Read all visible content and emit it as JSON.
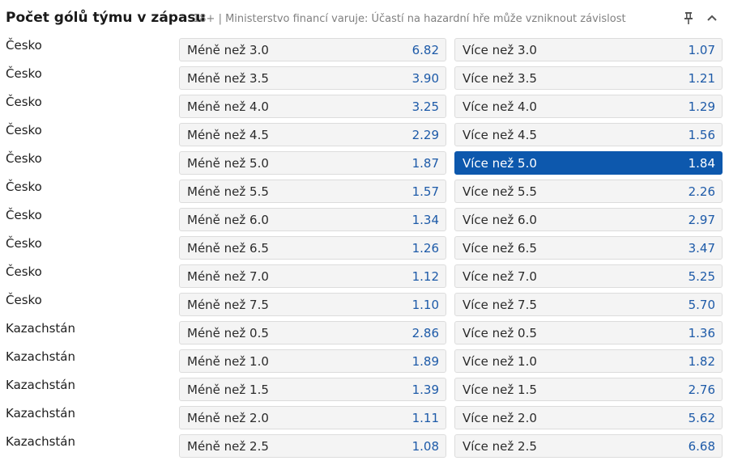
{
  "header": {
    "title": "Počet gólů týmu v zápasu",
    "disclaimer": "18+ | Ministerstvo financí varuje: Účastí na hazardní hře může vzniknout závislost",
    "pin_icon": "pin-icon",
    "collapse_icon": "chevron-up-icon"
  },
  "colors": {
    "accent": "#0d58ad",
    "odds_text": "#1d5aa8",
    "button_bg": "#f4f4f4"
  },
  "rows": [
    {
      "team": "Česko",
      "under": {
        "label": "Méně než 3.0",
        "odds": "6.82"
      },
      "over": {
        "label": "Více než 3.0",
        "odds": "1.07"
      }
    },
    {
      "team": "Česko",
      "under": {
        "label": "Méně než 3.5",
        "odds": "3.90"
      },
      "over": {
        "label": "Více než 3.5",
        "odds": "1.21"
      }
    },
    {
      "team": "Česko",
      "under": {
        "label": "Méně než 4.0",
        "odds": "3.25"
      },
      "over": {
        "label": "Více než 4.0",
        "odds": "1.29"
      }
    },
    {
      "team": "Česko",
      "under": {
        "label": "Méně než 4.5",
        "odds": "2.29"
      },
      "over": {
        "label": "Více než 4.5",
        "odds": "1.56"
      }
    },
    {
      "team": "Česko",
      "under": {
        "label": "Méně než 5.0",
        "odds": "1.87"
      },
      "over": {
        "label": "Více než 5.0",
        "odds": "1.84",
        "selected": true
      }
    },
    {
      "team": "Česko",
      "under": {
        "label": "Méně než 5.5",
        "odds": "1.57"
      },
      "over": {
        "label": "Více než 5.5",
        "odds": "2.26"
      }
    },
    {
      "team": "Česko",
      "under": {
        "label": "Méně než 6.0",
        "odds": "1.34"
      },
      "over": {
        "label": "Více než 6.0",
        "odds": "2.97"
      }
    },
    {
      "team": "Česko",
      "under": {
        "label": "Méně než 6.5",
        "odds": "1.26"
      },
      "over": {
        "label": "Více než 6.5",
        "odds": "3.47"
      }
    },
    {
      "team": "Česko",
      "under": {
        "label": "Méně než 7.0",
        "odds": "1.12"
      },
      "over": {
        "label": "Více než 7.0",
        "odds": "5.25"
      }
    },
    {
      "team": "Česko",
      "under": {
        "label": "Méně než 7.5",
        "odds": "1.10"
      },
      "over": {
        "label": "Více než 7.5",
        "odds": "5.70"
      }
    },
    {
      "team": "Kazachstán",
      "under": {
        "label": "Méně než 0.5",
        "odds": "2.86"
      },
      "over": {
        "label": "Více než 0.5",
        "odds": "1.36"
      }
    },
    {
      "team": "Kazachstán",
      "under": {
        "label": "Méně než 1.0",
        "odds": "1.89"
      },
      "over": {
        "label": "Více než 1.0",
        "odds": "1.82"
      }
    },
    {
      "team": "Kazachstán",
      "under": {
        "label": "Méně než 1.5",
        "odds": "1.39"
      },
      "over": {
        "label": "Více než 1.5",
        "odds": "2.76"
      }
    },
    {
      "team": "Kazachstán",
      "under": {
        "label": "Méně než 2.0",
        "odds": "1.11"
      },
      "over": {
        "label": "Více než 2.0",
        "odds": "5.62"
      }
    },
    {
      "team": "Kazachstán",
      "under": {
        "label": "Méně než 2.5",
        "odds": "1.08"
      },
      "over": {
        "label": "Více než 2.5",
        "odds": "6.68"
      }
    }
  ]
}
